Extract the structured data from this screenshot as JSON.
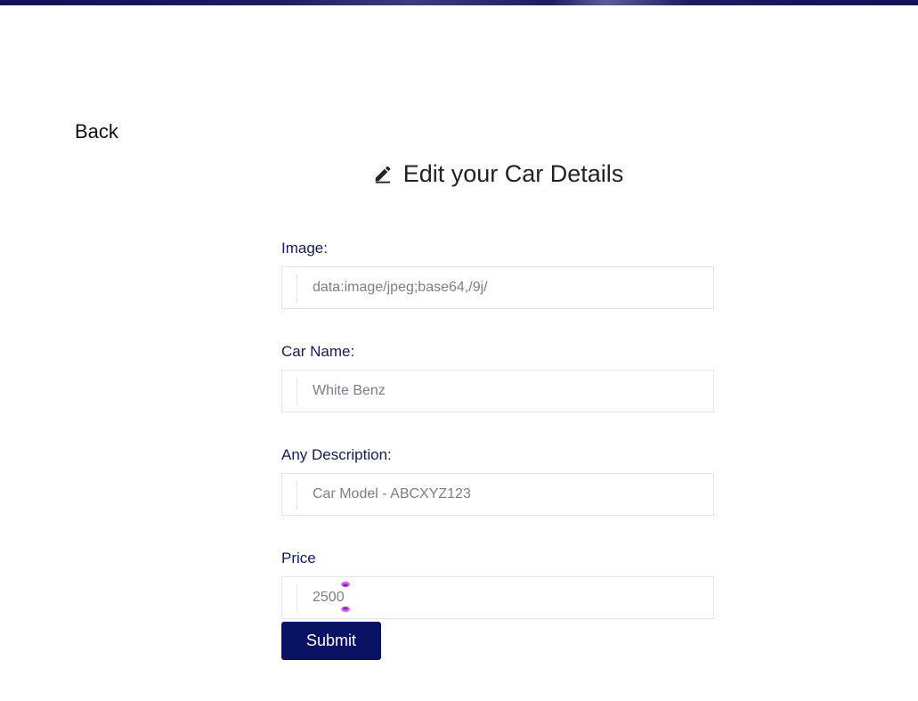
{
  "header": {
    "back_label": "Back",
    "title": "Edit your Car Details",
    "title_icon": "pencil-edit-icon"
  },
  "form": {
    "fields": [
      {
        "label": "Image:",
        "value": "data:image/jpeg;base64,/9j/"
      },
      {
        "label": "Car Name:",
        "value": "White Benz"
      },
      {
        "label": "Any Description:",
        "value": "Car Model - ABCXYZ123"
      },
      {
        "label": "Price",
        "value": "2500"
      }
    ],
    "submit_label": "Submit"
  },
  "colors": {
    "accent": "#0a1263",
    "label": "#141c5a",
    "input_text": "#7b7f8a",
    "border": "#e3e6ec",
    "text_cursor": "#d36bf0"
  }
}
